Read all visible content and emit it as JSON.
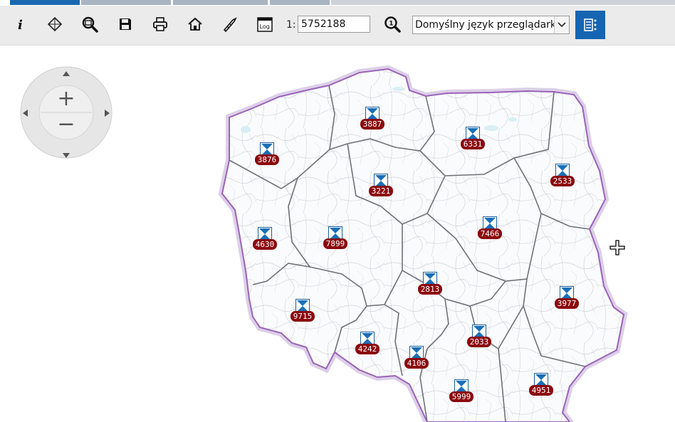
{
  "toolbar": {
    "scale_prefix": "1:",
    "scale_value": "5752188",
    "language_select": {
      "selected": "Domyślny język przeglądarki"
    },
    "log_label": "Log",
    "icons": [
      "info-icon",
      "extent-icon",
      "zoom-icon",
      "save-icon",
      "print-icon",
      "home-icon",
      "measure-icon",
      "log-icon",
      "zoom-scale-icon",
      "layers-icon"
    ]
  },
  "colors": {
    "accent_blue": "#1565b3",
    "marker_badge": "#8b0a0f",
    "border_purple": "#9a63b8",
    "tab_blue": "#1a68b0",
    "tab_gray": "#a9b4c2"
  },
  "map": {
    "navigation": {
      "zoom_in": "+",
      "zoom_out": "−"
    },
    "markers": [
      {
        "label": "3887"
      },
      {
        "label": "6331"
      },
      {
        "label": "3876"
      },
      {
        "label": "3221"
      },
      {
        "label": "2533"
      },
      {
        "label": "4630"
      },
      {
        "label": "7899"
      },
      {
        "label": "7466"
      },
      {
        "label": "2813"
      },
      {
        "label": "9715"
      },
      {
        "label": "3977"
      },
      {
        "label": "4242"
      },
      {
        "label": "2033"
      },
      {
        "label": "4106"
      },
      {
        "label": "5999"
      },
      {
        "label": "4951"
      }
    ]
  }
}
